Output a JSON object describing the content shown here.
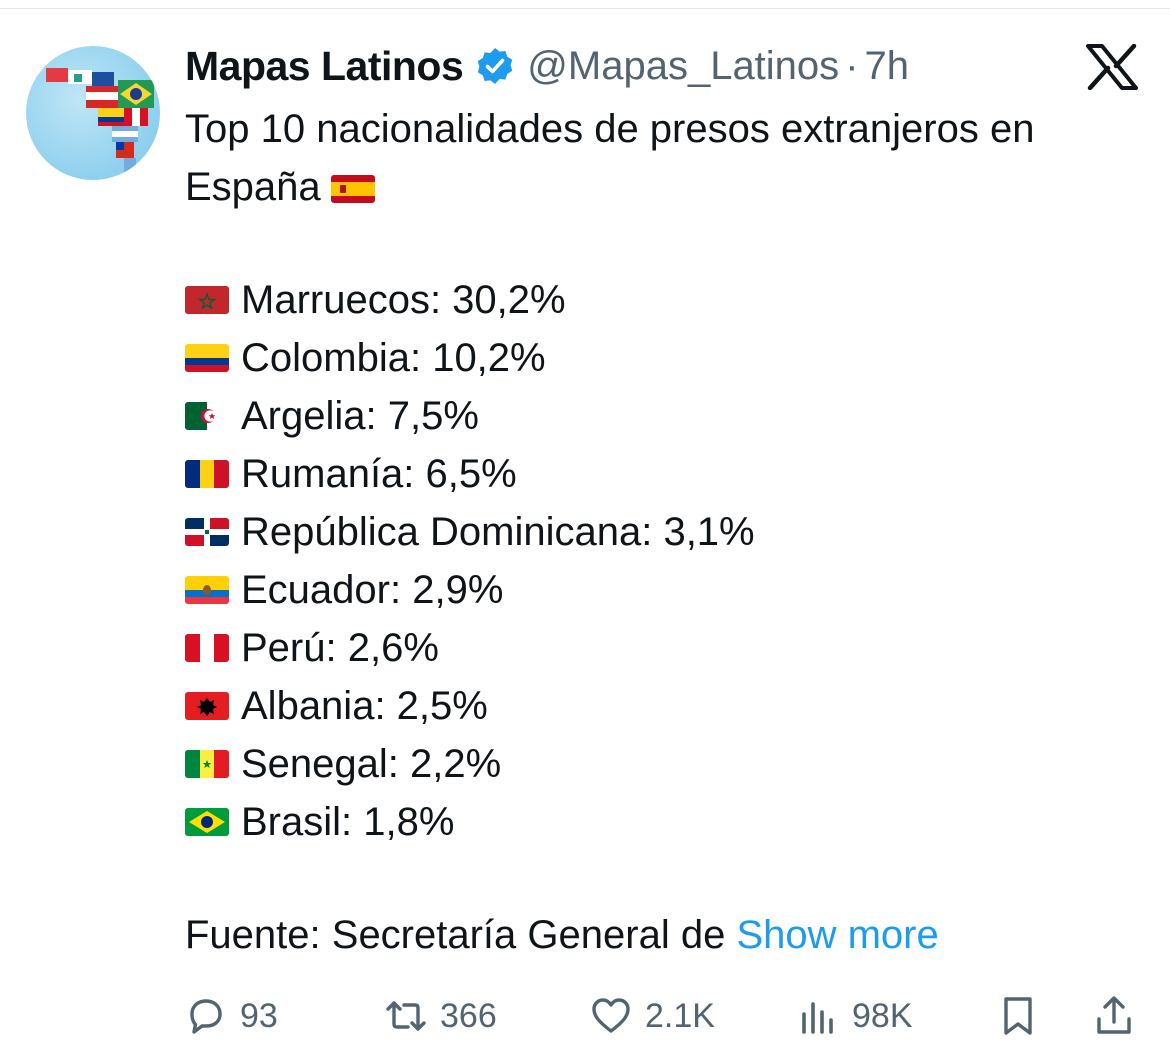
{
  "tweet": {
    "author": {
      "display_name": "Mapas Latinos",
      "handle": "@Mapas_Latinos",
      "verified": true,
      "avatar_icon": "latin-america-flags-globe"
    },
    "separator": "·",
    "time": "7h",
    "platform_logo": "x-logo",
    "headline": "Top 10 nacionalidades de presos extranjeros en España",
    "headline_flag": "flag-spain",
    "items": [
      {
        "text": "Marruecos: 30,2%",
        "flag": "flag-morocco",
        "value": 30.2
      },
      {
        "text": "Colombia: 10,2%",
        "flag": "flag-colombia",
        "value": 10.2
      },
      {
        "text": "Argelia: 7,5%",
        "flag": "flag-algeria",
        "value": 7.5
      },
      {
        "text": "Rumanía: 6,5%",
        "flag": "flag-romania",
        "value": 6.5
      },
      {
        "text": "República Dominicana: 3,1%",
        "flag": "flag-dominican-republic",
        "value": 3.1
      },
      {
        "text": "Ecuador: 2,9%",
        "flag": "flag-ecuador",
        "value": 2.9
      },
      {
        "text": "Perú: 2,6%",
        "flag": "flag-peru",
        "value": 2.6
      },
      {
        "text": "Albania: 2,5%",
        "flag": "flag-albania",
        "value": 2.5
      },
      {
        "text": "Senegal: 2,2%",
        "flag": "flag-senegal",
        "value": 2.2
      },
      {
        "text": "Brasil: 1,8%",
        "flag": "flag-brazil",
        "value": 1.8
      }
    ],
    "source_text": "Fuente: Secretaría General de ",
    "show_more": "Show more",
    "actions": {
      "replies": "93",
      "retweets": "366",
      "likes": "2.1K",
      "views": "98K"
    },
    "colors": {
      "link": "#1d9bf0",
      "secondary_text": "#536471",
      "verified_badge": "#1d9bf0"
    }
  }
}
